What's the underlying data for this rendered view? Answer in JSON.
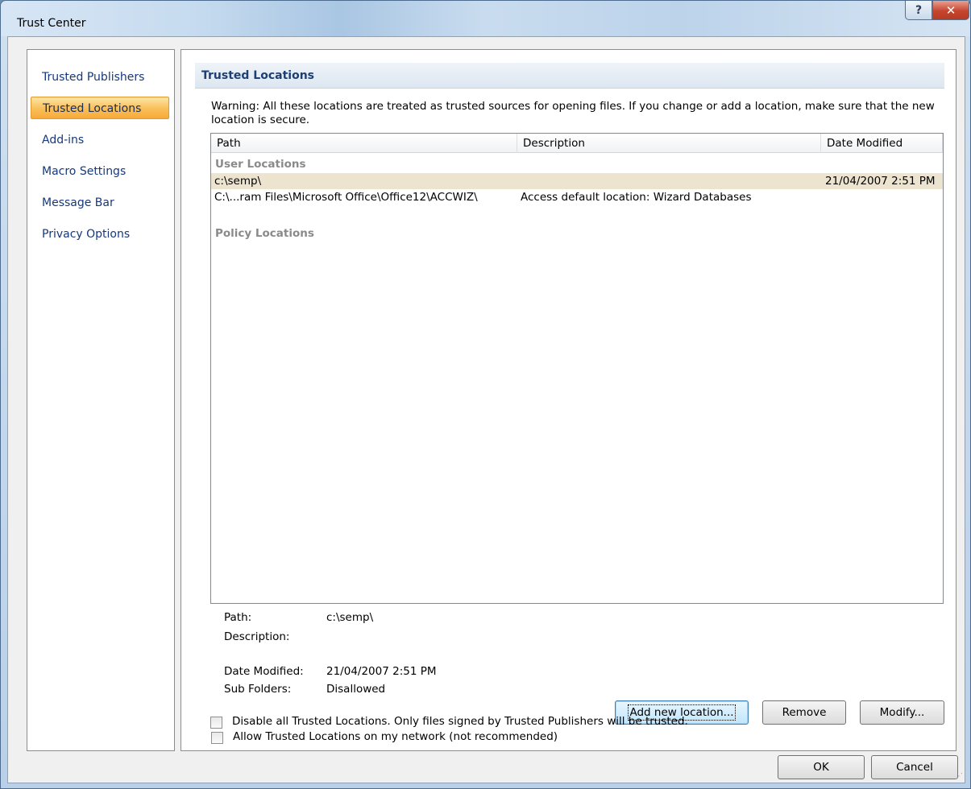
{
  "window": {
    "title": "Trust Center",
    "help_glyph": "?",
    "close_glyph": "✕"
  },
  "sidebar": {
    "items": [
      {
        "label": "Trusted Publishers"
      },
      {
        "label": "Trusted Locations",
        "selected": true
      },
      {
        "label": "Add-ins"
      },
      {
        "label": "Macro Settings"
      },
      {
        "label": "Message Bar"
      },
      {
        "label": "Privacy Options"
      }
    ]
  },
  "main": {
    "section_title": "Trusted Locations",
    "warning": "Warning: All these locations are treated as trusted sources for opening files.  If you change or add a location, make sure that the new location is secure.",
    "columns": [
      "Path",
      "Description",
      "Date Modified"
    ],
    "groups": {
      "user": "User Locations",
      "policy": "Policy Locations"
    },
    "rows": [
      {
        "path": "c:\\semp\\",
        "description": "",
        "date": "21/04/2007 2:51 PM",
        "selected": true
      },
      {
        "path": "C:\\...ram Files\\Microsoft Office\\Office12\\ACCWIZ\\",
        "description": "Access default location: Wizard Databases",
        "date": ""
      }
    ],
    "details": {
      "path_label": "Path:",
      "path_value": "c:\\semp\\",
      "description_label": "Description:",
      "description_value": "",
      "date_label": "Date Modified:",
      "date_value": "21/04/2007 2:51 PM",
      "subfolders_label": "Sub Folders:",
      "subfolders_value": "Disallowed"
    },
    "buttons": {
      "add": "Add new location...",
      "remove": "Remove",
      "modify": "Modify..."
    },
    "checkboxes": {
      "allow_network": "Allow Trusted Locations on my network (not recommended)",
      "disable_all": "Disable all Trusted Locations. Only files signed by Trusted Publishers will be trusted."
    }
  },
  "footer": {
    "ok": "OK",
    "cancel": "Cancel"
  }
}
